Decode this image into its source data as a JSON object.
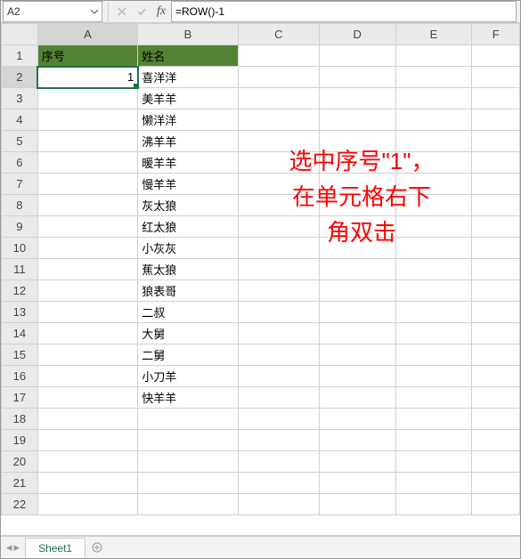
{
  "nameBox": "A2",
  "formula": "=ROW()-1",
  "columns": [
    "A",
    "B",
    "C",
    "D",
    "E",
    "F"
  ],
  "headers": {
    "A": "序号",
    "B": "姓名"
  },
  "cells": {
    "A2": "1",
    "B2": "喜洋洋",
    "B3": "美羊羊",
    "B4": "懒洋洋",
    "B5": "沸羊羊",
    "B6": "暖羊羊",
    "B7": "慢羊羊",
    "B8": "灰太狼",
    "B9": "红太狼",
    "B10": "小灰灰",
    "B11": "蕉太狼",
    "B12": "狼表哥",
    "B13": "二叔",
    "B14": "大舅",
    "B15": "二舅",
    "B16": "小刀羊",
    "B17": "快羊羊"
  },
  "selectedCell": "A2",
  "rowCount": 22,
  "annotation": {
    "line1": "选中序号\"1\"，",
    "line2": "在单元格右下",
    "line3": "角双击"
  },
  "sheetTab": "Sheet1"
}
